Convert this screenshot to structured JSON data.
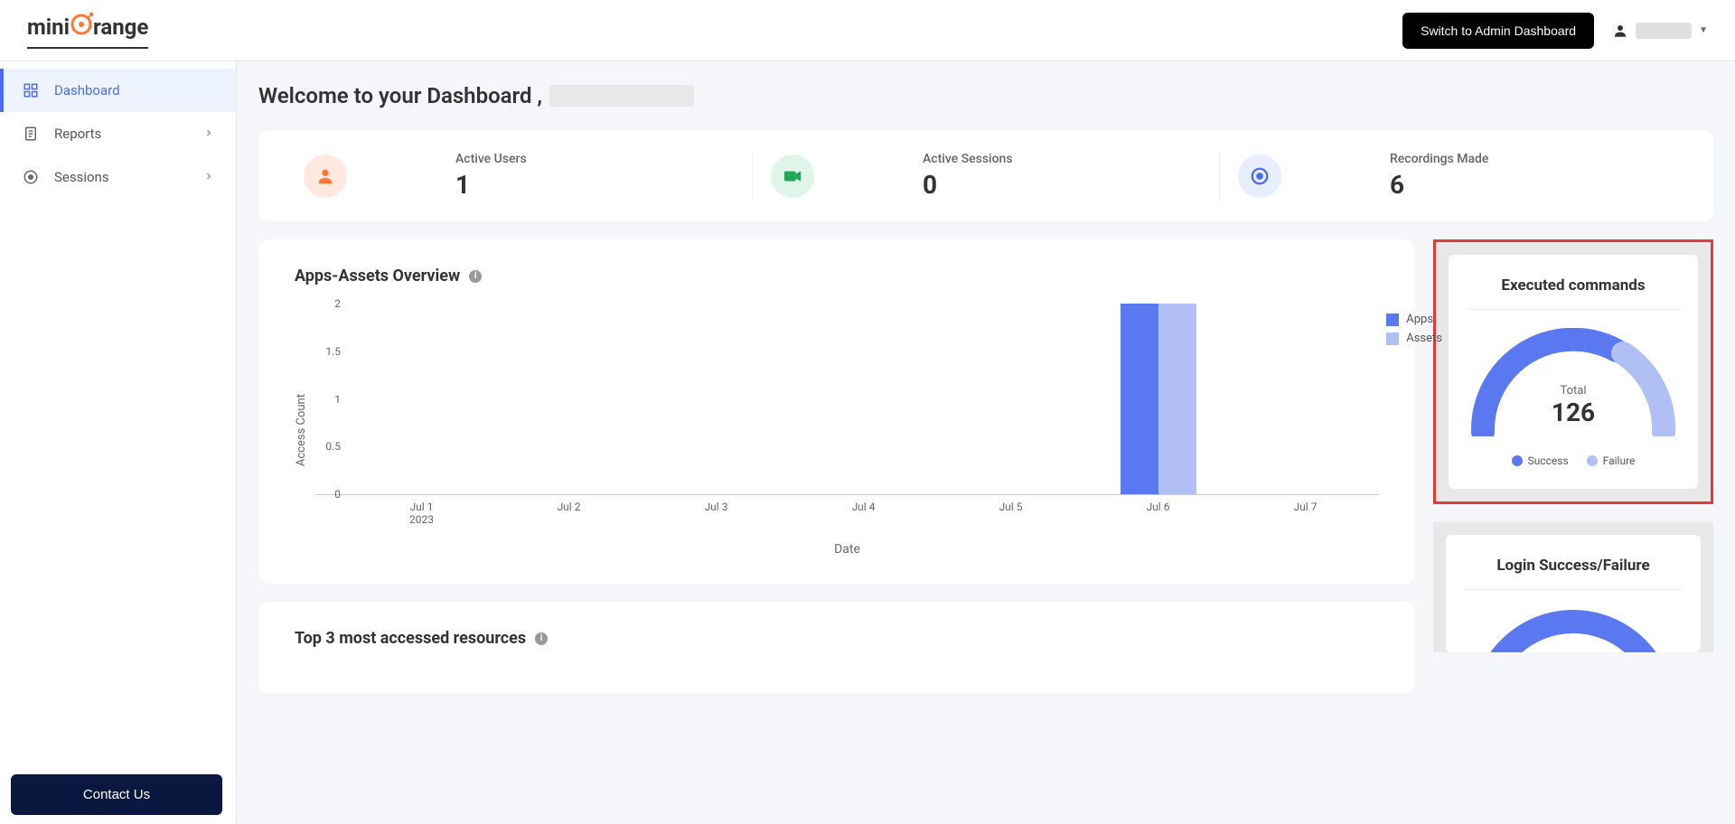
{
  "header": {
    "logo_text_left": "mini",
    "logo_text_right": "range",
    "admin_button": "Switch to Admin Dashboard"
  },
  "sidebar": {
    "items": [
      {
        "label": "Dashboard",
        "icon": "grid"
      },
      {
        "label": "Reports",
        "icon": "doc"
      },
      {
        "label": "Sessions",
        "icon": "target"
      }
    ]
  },
  "page": {
    "welcome": "Welcome to your Dashboard ,"
  },
  "stats": {
    "active_users": {
      "label": "Active Users",
      "value": "1"
    },
    "active_sessions": {
      "label": "Active Sessions",
      "value": "0"
    },
    "recordings": {
      "label": "Recordings Made",
      "value": "6"
    }
  },
  "apps_assets": {
    "title": "Apps-Assets Overview",
    "x_label": "Date",
    "y_label": "Access Count",
    "legend_apps": "Apps",
    "legend_assets": "Assets"
  },
  "executed": {
    "title": "Executed commands",
    "total_label": "Total",
    "total_value": "126",
    "legend_success": "Success",
    "legend_failure": "Failure"
  },
  "login_sf": {
    "title": "Login Success/Failure"
  },
  "resources": {
    "title": "Top 3 most accessed resources"
  },
  "contact": "Contact Us",
  "chart_data": [
    {
      "type": "bar",
      "title": "Apps-Assets Overview",
      "xlabel": "Date",
      "ylabel": "Access Count",
      "ylim": [
        0,
        2
      ],
      "y_ticks": [
        0,
        0.5,
        1,
        1.5,
        2
      ],
      "categories": [
        "Jul 1 2023",
        "Jul 2",
        "Jul 3",
        "Jul 4",
        "Jul 5",
        "Jul 6",
        "Jul 7"
      ],
      "series": [
        {
          "name": "Apps",
          "values": [
            0,
            0,
            0,
            0,
            0,
            2,
            0
          ],
          "color": "#5a78f0"
        },
        {
          "name": "Assets",
          "values": [
            0,
            0,
            0,
            0,
            0,
            2,
            0
          ],
          "color": "#b0c0f5"
        }
      ]
    },
    {
      "type": "pie",
      "title": "Executed commands",
      "total": 126,
      "series": [
        {
          "name": "Success",
          "value": 84,
          "color": "#5a78f0"
        },
        {
          "name": "Failure",
          "value": 42,
          "color": "#b0c0f5"
        }
      ]
    }
  ]
}
